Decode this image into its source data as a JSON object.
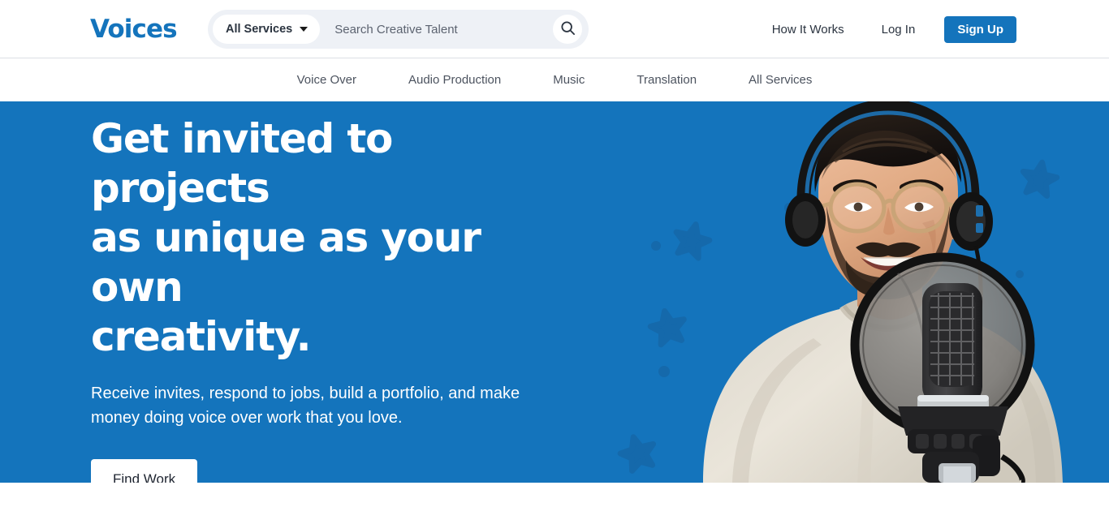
{
  "header": {
    "logo_text": "Voices",
    "search": {
      "category_label": "All Services",
      "placeholder": "Search Creative Talent",
      "value": "",
      "search_icon": "search-icon",
      "caret_icon": "chevron-down-icon"
    },
    "links": [
      {
        "label": "How It Works"
      },
      {
        "label": "Log In"
      }
    ],
    "signup_label": "Sign Up"
  },
  "subnav": {
    "items": [
      {
        "label": "Voice Over"
      },
      {
        "label": "Audio Production"
      },
      {
        "label": "Music"
      },
      {
        "label": "Translation"
      },
      {
        "label": "All Services"
      }
    ]
  },
  "hero": {
    "title_line1": "Get invited to projects",
    "title_line2": "as unique as your own",
    "title_line3": "creativity.",
    "subtitle": "Receive invites, respond to jobs, build a portfolio, and make money doing voice over work that you love.",
    "cta_label": "Find Work",
    "image_alt": "smiling-man-with-headphones-at-studio-microphone"
  },
  "colors": {
    "brand_blue": "#1474bc",
    "hero_bg": "#1474bc",
    "deco_star": "#1569ab",
    "search_bg": "#eef1f6",
    "text_dark": "#2b3440",
    "text_muted": "#4c535f",
    "white": "#ffffff"
  }
}
